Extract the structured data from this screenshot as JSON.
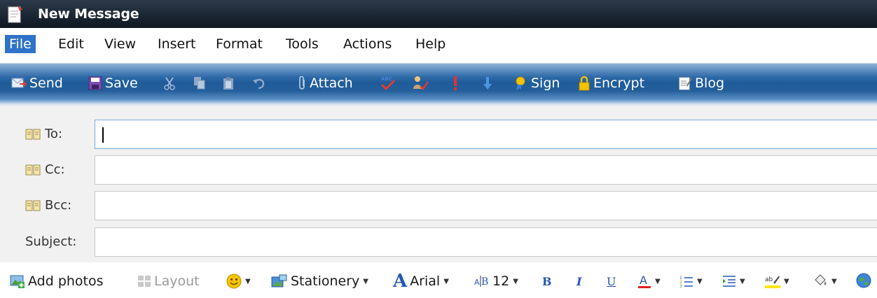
{
  "window": {
    "title": "New Message"
  },
  "menu": [
    "File",
    "Edit",
    "View",
    "Insert",
    "Format",
    "Tools",
    "Actions",
    "Help"
  ],
  "toolbar": {
    "send": "Send",
    "save": "Save",
    "attach": "Attach",
    "sign": "Sign",
    "encrypt": "Encrypt",
    "blog": "Blog"
  },
  "fields": {
    "to": {
      "label": "To:",
      "value": ""
    },
    "cc": {
      "label": "Cc:",
      "value": ""
    },
    "bcc": {
      "label": "Bcc:",
      "value": ""
    },
    "subject": {
      "label": "Subject:",
      "value": ""
    }
  },
  "format": {
    "add_photos": "Add photos",
    "layout": "Layout",
    "stationery": "Stationery",
    "font": "Arial",
    "font_size": "12"
  },
  "colors": {
    "accent": "#2f72c9",
    "toolbar": "#2b659f",
    "highlight": "#ffe600",
    "font_color": "#e02020"
  }
}
